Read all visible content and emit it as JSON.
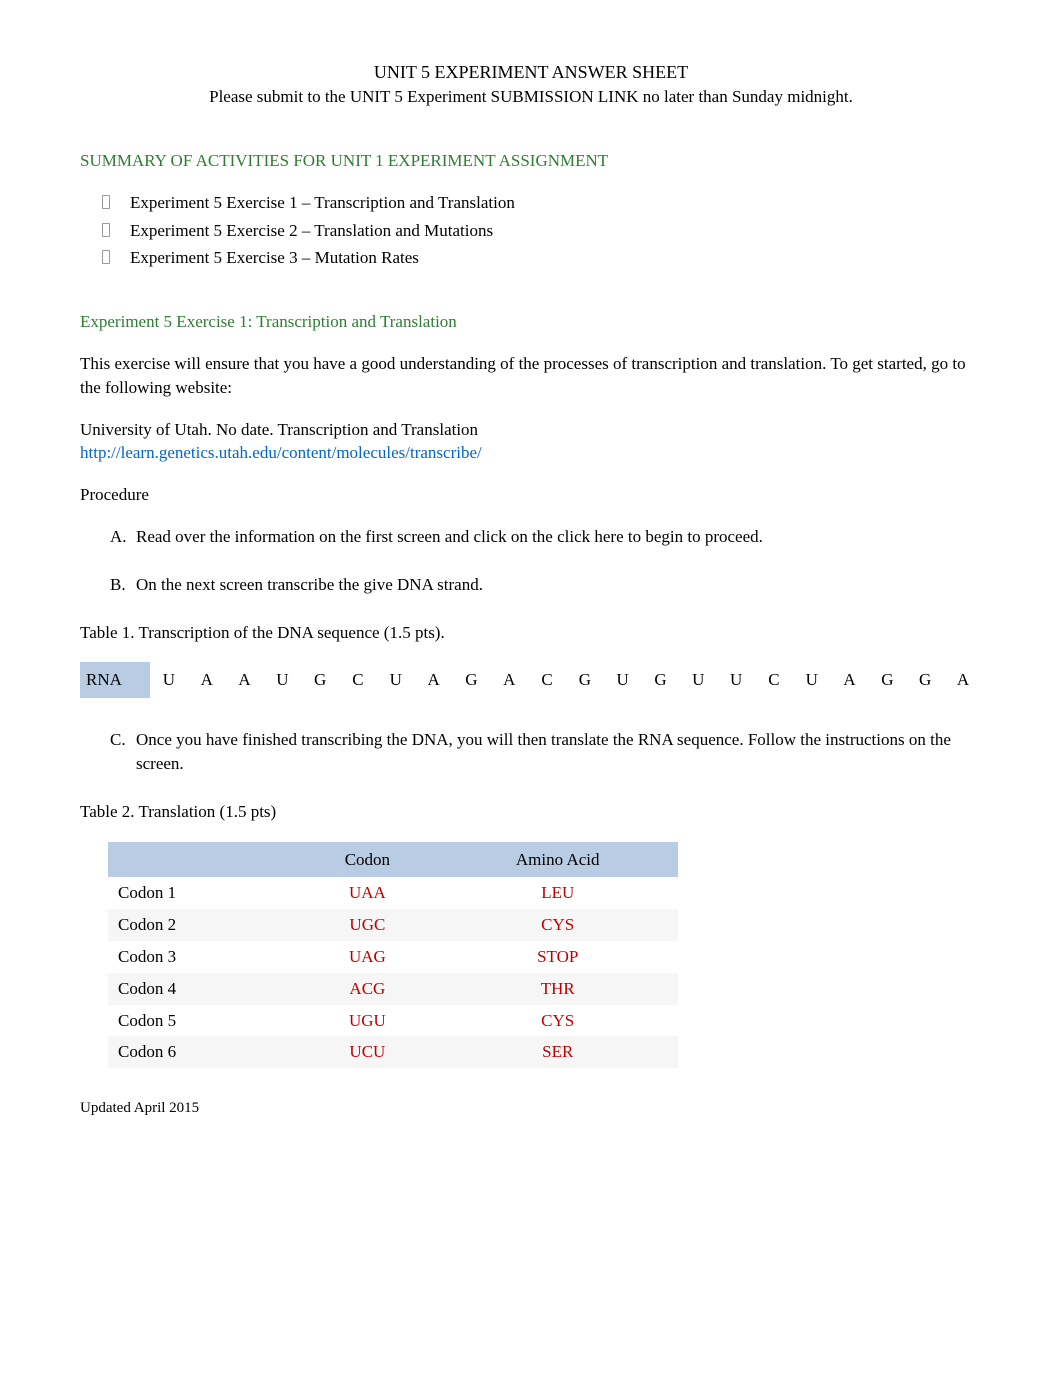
{
  "header": {
    "title": "UNIT 5 EXPERIMENT ANSWER SHEET",
    "subtitle": "Please submit to the UNIT 5 Experiment SUBMISSION LINK no later than Sunday midnight."
  },
  "summary": {
    "heading": "SUMMARY OF ACTIVITIES FOR UNIT 1 EXPERIMENT ASSIGNMENT",
    "items": [
      "Experiment 5 Exercise 1 – Transcription and Translation",
      "Experiment 5  Exercise 2 – Translation and Mutations",
      "Experiment 5 Exercise 3 – Mutation Rates"
    ]
  },
  "exercise1": {
    "heading": "Experiment 5 Exercise 1: Transcription and Translation",
    "intro": "This exercise will ensure that you have a good understanding of the processes of transcription and translation. To get started, go to the following website:",
    "source_line": "University of Utah. No date. Transcription and Translation",
    "link": "http://learn.genetics.utah.edu/content/molecules/transcribe/",
    "procedure_label": "Procedure",
    "steps_ab": [
      "Read over the information on the first screen and click on the  click here to begin  to proceed.",
      "On the next screen transcribe the give DNA strand."
    ],
    "table1_caption": "Table 1. Transcription of the DNA sequence (1.5 pts).",
    "rna": {
      "label": "RNA",
      "bases": [
        "U",
        "A",
        "A",
        "U",
        "G",
        "C",
        "U",
        "A",
        "G",
        "A",
        "C",
        "G",
        "U",
        "G",
        "U",
        "U",
        "C",
        "U",
        "A",
        "G",
        "G",
        "A"
      ]
    },
    "steps_c": [
      "Once you have finished transcribing the DNA, you will then translate the RNA sequence.  Follow the instructions on the screen."
    ],
    "table2_caption": "Table 2. Translation (1.5 pts)",
    "trans_headers": [
      "",
      "Codon",
      "Amino Acid"
    ],
    "trans_rows": [
      {
        "label": "Codon 1",
        "codon": "UAA",
        "amino": "LEU"
      },
      {
        "label": "Codon 2",
        "codon": "UGC",
        "amino": "CYS"
      },
      {
        "label": "Codon 3",
        "codon": "UAG",
        "amino": "STOP"
      },
      {
        "label": "Codon 4",
        "codon": "ACG",
        "amino": "THR"
      },
      {
        "label": "Codon 5",
        "codon": "UGU",
        "amino": "CYS"
      },
      {
        "label": "Codon 6",
        "codon": "UCU",
        "amino": "SER"
      }
    ]
  },
  "footer": "Updated April 2015"
}
